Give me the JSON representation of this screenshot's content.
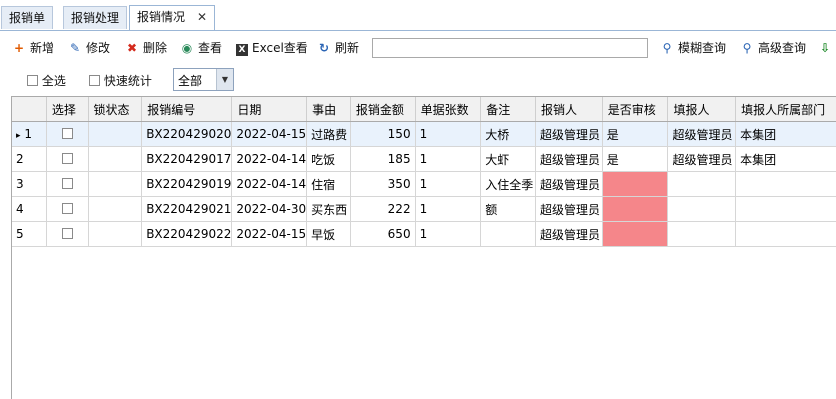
{
  "tabs": [
    {
      "label": "报销单"
    },
    {
      "label": "报销处理"
    },
    {
      "label": "报销情况",
      "close": "✕"
    }
  ],
  "toolbar": {
    "add": "新增",
    "edit": "修改",
    "delete": "删除",
    "view": "查看",
    "excel": "Excel查看",
    "refresh": "刷新",
    "search_value": "",
    "fuzzy": "模糊查询",
    "advanced": "高级查询"
  },
  "filters": {
    "select_all": "全选",
    "quick_stats": "快速统计",
    "scope": "全部"
  },
  "columns": [
    "选择",
    "锁状态",
    "报销编号",
    "日期",
    "事由",
    "报销金额",
    "单据张数",
    "备注",
    "报销人",
    "是否审核",
    "填报人",
    "填报人所属部门"
  ],
  "rows": [
    {
      "idx": "1",
      "marker": "▸",
      "code": "BX220429020",
      "date": "2022-04-15",
      "reason": "过路费",
      "amount": "150",
      "count": "1",
      "note": "大桥",
      "person": "超级管理员",
      "approved": "是",
      "filler": "超级管理员",
      "dept": "本集团"
    },
    {
      "idx": "2",
      "marker": "",
      "code": "BX220429017",
      "date": "2022-04-14",
      "reason": "吃饭",
      "amount": "185",
      "count": "1",
      "note": "大虾",
      "person": "超级管理员",
      "approved": "是",
      "filler": "超级管理员",
      "dept": "本集团"
    },
    {
      "idx": "3",
      "marker": "",
      "code": "BX220429019",
      "date": "2022-04-14",
      "reason": "住宿",
      "amount": "350",
      "count": "1",
      "note": "入住全季",
      "person": "超级管理员",
      "approved": "",
      "filler": "",
      "dept": ""
    },
    {
      "idx": "4",
      "marker": "",
      "code": "BX220429021",
      "date": "2022-04-30",
      "reason": "买东西",
      "amount": "222",
      "count": "1",
      "note": "额",
      "person": "超级管理员",
      "approved": "",
      "filler": "",
      "dept": ""
    },
    {
      "idx": "5",
      "marker": "",
      "code": "BX220429022",
      "date": "2022-04-15",
      "reason": "早饭",
      "amount": "650",
      "count": "1",
      "note": "",
      "person": "超级管理员",
      "approved": "",
      "filler": "",
      "dept": ""
    }
  ],
  "colors": {
    "accent": "#2a64b4",
    "unapproved": "#f5868a",
    "selected_row": "#e9f2fc"
  }
}
